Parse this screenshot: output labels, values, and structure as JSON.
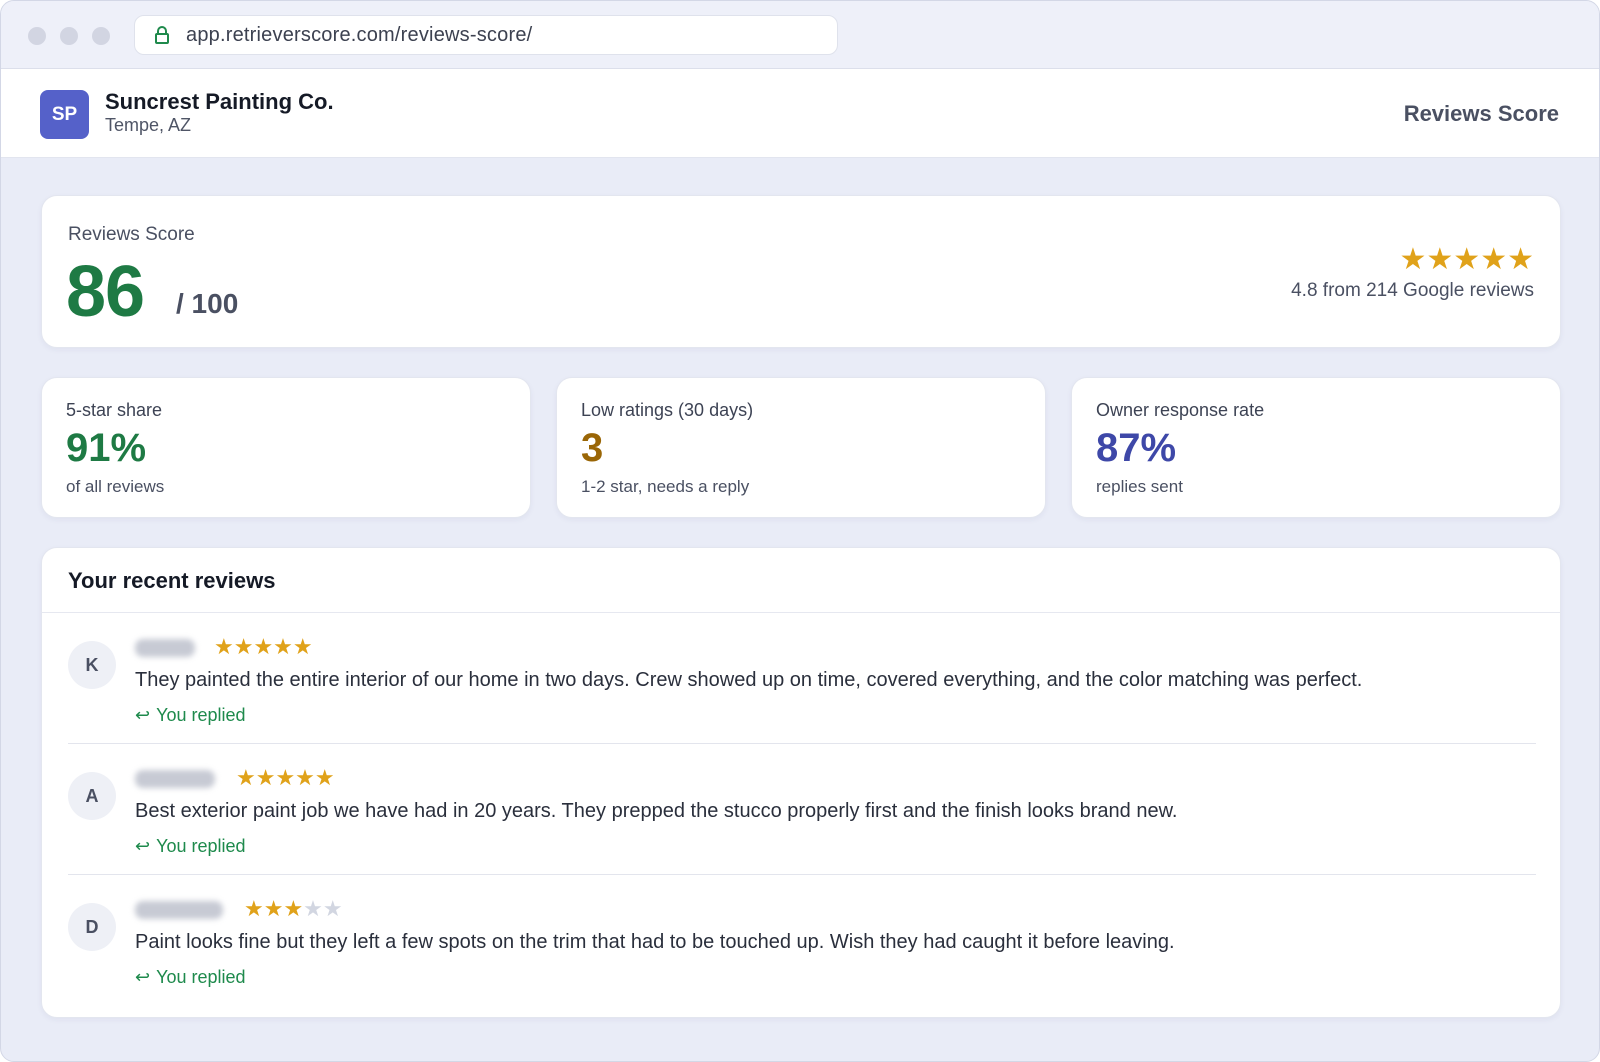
{
  "browser": {
    "url": "app.retrieverscore.com/reviews-score/",
    "lock_icon": "lock-icon"
  },
  "header": {
    "logo_initials": "SP",
    "business_name": "Suncrest Painting Co.",
    "location": "Tempe, AZ",
    "page_title": "Reviews Score"
  },
  "score": {
    "label": "Reviews Score",
    "value": "86",
    "max": "/ 100",
    "stars": "★★★★★",
    "star_rating": 4.8,
    "summary": "4.8 from 214 Google reviews"
  },
  "stats": [
    {
      "label": "5-star share",
      "value": "91%",
      "sub": "of all reviews",
      "color": "#1e7a44"
    },
    {
      "label": "Low ratings (30 days)",
      "value": "3",
      "sub": "1-2 star, needs a reply",
      "color": "#9a6606"
    },
    {
      "label": "Owner response rate",
      "value": "87%",
      "sub": "replies sent",
      "color": "#3e48a8"
    }
  ],
  "reviews": {
    "title": "Your recent reviews",
    "items": [
      {
        "initial": "K",
        "rating": 5,
        "stars_on": "★★★★★",
        "stars_off": "",
        "text": "They painted the entire interior of our home in two days. Crew showed up on time, covered everything, and the color matching was perfect.",
        "reply_icon": "↩",
        "reply_status": "You replied"
      },
      {
        "initial": "A",
        "rating": 5,
        "stars_on": "★★★★★",
        "stars_off": "",
        "text": "Best exterior paint job we have had in 20 years. They prepped the stucco properly first and the finish looks brand new.",
        "reply_icon": "↩",
        "reply_status": "You replied"
      },
      {
        "initial": "D",
        "rating": 3,
        "stars_on": "★★★",
        "stars_off": "★★",
        "text": "Paint looks fine but they left a few spots on the trim that had to be touched up. Wish they had caught it before leaving.",
        "reply_icon": "↩",
        "reply_status": "You replied"
      }
    ]
  },
  "colors": {
    "accent_green": "#1e7a44",
    "star_gold": "#e0a21a",
    "logo_indigo": "#5561c9",
    "reply_green": "#1e8a4c"
  }
}
